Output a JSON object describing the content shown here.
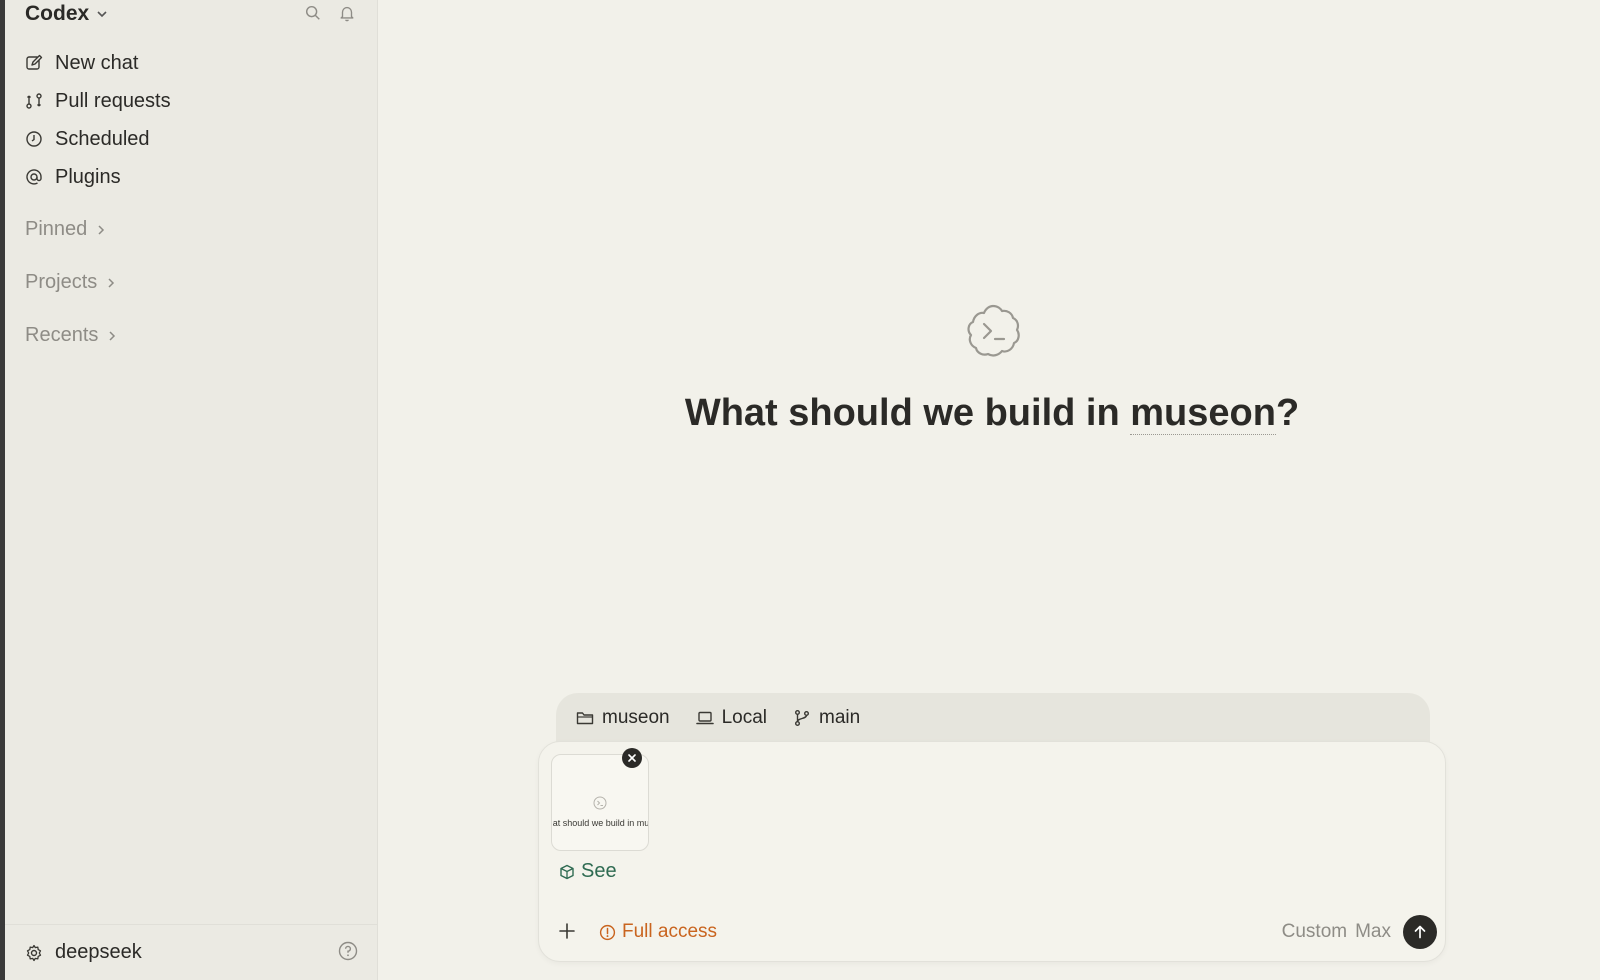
{
  "app": {
    "name": "Codex"
  },
  "sidebar": {
    "nav": [
      {
        "label": "New chat",
        "icon": "compose-icon"
      },
      {
        "label": "Pull requests",
        "icon": "pull-request-icon"
      },
      {
        "label": "Scheduled",
        "icon": "clock-icon"
      },
      {
        "label": "Plugins",
        "icon": "at-sign-icon"
      }
    ],
    "sections": {
      "pinned": "Pinned",
      "projects": "Projects",
      "recents": "Recents"
    },
    "user": {
      "name": "deepseek"
    }
  },
  "main": {
    "title_prefix": "What should we build in ",
    "project": "museon",
    "title_suffix": "?"
  },
  "composer": {
    "context": {
      "folder": "museon",
      "environment": "Local",
      "branch": "main"
    },
    "attachment": {
      "preview_text": "at should we build in mu"
    },
    "skill": "See",
    "access": "Full access",
    "model": {
      "name": "Custom",
      "effort": "Max"
    }
  },
  "colors": {
    "accent_orange": "#c9641f",
    "skill_green": "#2f6b52",
    "background": "#f2f1ea",
    "sidebar": "#ebeae3"
  }
}
